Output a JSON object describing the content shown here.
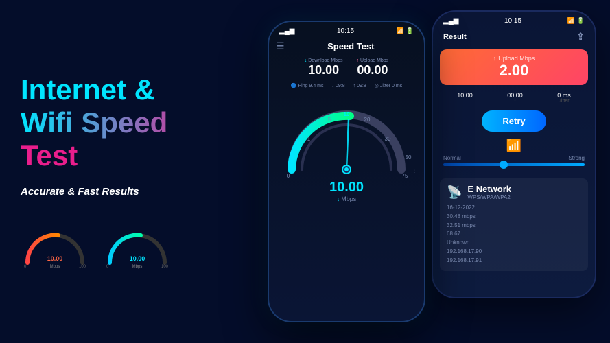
{
  "left": {
    "title_line1": "Internet &",
    "title_line2": "Wifi Speed",
    "title_line3": "Test",
    "subtitle": "Accurate & Fast Results"
  },
  "phone_front": {
    "status_time": "10:15",
    "header_title": "Speed Test",
    "download_label": "Download Mbps",
    "download_value": "10.00",
    "upload_label": "Upload Mbps",
    "upload_value": "00.00",
    "ping_label": "Ping",
    "ping_value": "9.4 ms",
    "jitter_label": "Jitter",
    "jitter_value": "0 ms",
    "speed_number": "10.00",
    "speed_unit": "Mbps"
  },
  "phone_back": {
    "status_time": "10:15",
    "result_title": "Result",
    "upload_card_label": "Upload Mbps",
    "upload_card_value": "2.00",
    "download_stat": "10:00",
    "upload_stat": "00:00",
    "jitter_stat": "0 ms",
    "retry_label": "Retry",
    "signal_weak": "Normal",
    "signal_strong": "Strong",
    "network_name": "E Network",
    "network_type": "WPS/WPA/WPA2",
    "date": "16-12-2022",
    "dl_speed": "30.48 mbps",
    "ul_speed": "32.51 mbps",
    "ping_ms": "68.67",
    "location": "Unknown",
    "ip1": "192.168.17.90",
    "ip2": "192.168.17.91"
  }
}
